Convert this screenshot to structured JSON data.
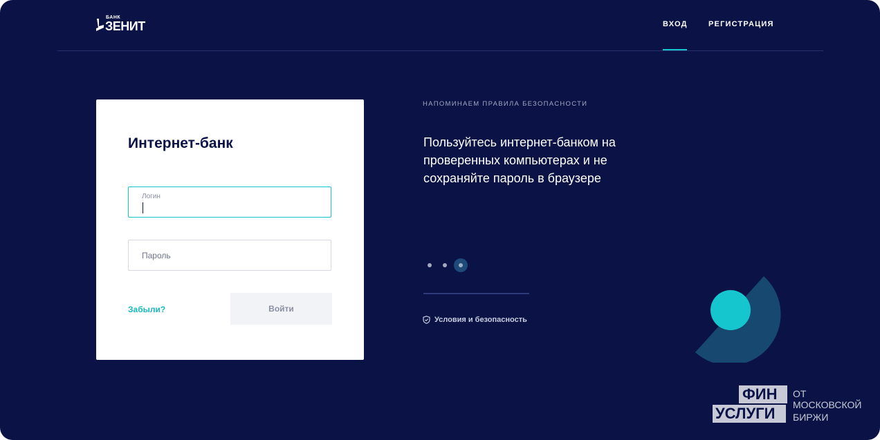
{
  "header": {
    "logo_small": "БАНК",
    "logo_main": "ЗЕНИТ",
    "nav_login": "ВХОД",
    "nav_register": "РЕГИСТРАЦИЯ"
  },
  "login_card": {
    "title": "Интернет-банк",
    "login_label": "Логин",
    "password_placeholder": "Пароль",
    "forgot_link": "Забыли?",
    "submit_button": "Войти"
  },
  "info": {
    "reminder_heading": "НАПОМИНАЕМ ПРАВИЛА БЕЗОПАСНОСТИ",
    "tip_text": "Пользуйтесь интернет-банком на проверенных компьютерах и не сохраняйте пароль в браузере",
    "slides_total": 3,
    "slide_active": 3,
    "terms_link": "Условия и безопасность"
  },
  "badge": {
    "box_top": "ФИН",
    "box_bottom": "УСЛУГИ",
    "line1": "ОТ",
    "line2": "МОСКОВСКОЙ",
    "line3": "БИРЖИ"
  },
  "colors": {
    "background": "#0a1246",
    "accent": "#16c6cf",
    "card": "#ffffff"
  }
}
